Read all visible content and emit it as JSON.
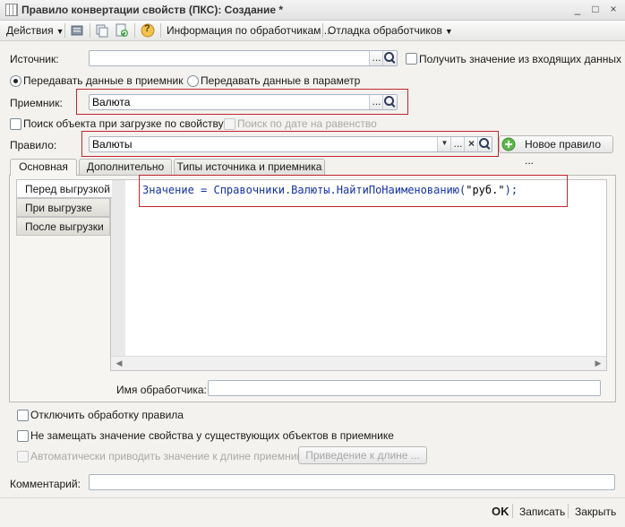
{
  "window": {
    "title": "Правило конвертации свойств (ПКС): Создание *",
    "buttons": [
      "_",
      "□",
      "×"
    ]
  },
  "toolbar": {
    "actions_label": "Действия",
    "help_glyph": "?",
    "handlers_info_label": "Информация по обработчикам ...",
    "debug_label": "Отладка обработчиков"
  },
  "form": {
    "source_label": "Источник:",
    "source_value": "",
    "get_from_incoming_label": "Получить значение из входящих данных",
    "pass_to_receiver_label": "Передавать данные в приемник",
    "pass_to_param_label": "Передавать данные в параметр",
    "receiver_label": "Приемник:",
    "receiver_value": "Валюта",
    "search_by_property_label": "Поиск объекта при загрузке по свойству",
    "search_by_date_label": "Поиск по дате на равенство",
    "rule_label": "Правило:",
    "rule_value": "Валюты",
    "new_rule_label": "Новое правило ...",
    "ellipsis": "...",
    "clear_glyph": "×",
    "dropdown_glyph": "▼"
  },
  "tabs": [
    {
      "label": "Основная",
      "active": true
    },
    {
      "label": "Дополнительно",
      "active": false
    },
    {
      "label": "Типы источника и приемника",
      "active": false
    }
  ],
  "handlers": [
    {
      "label": "Перед выгрузкой",
      "active": true
    },
    {
      "label": "При выгрузке",
      "active": false
    },
    {
      "label": "После выгрузки",
      "active": false
    }
  ],
  "editor": {
    "code_prefix": "Значение = Справочники.Валюты.НайтиПоНаименованию(",
    "code_string": "\"руб.\"",
    "code_suffix": ");"
  },
  "handler_name_label": "Имя обработчика:",
  "handler_name_value": "",
  "options": {
    "disable_rule_label": "Отключить обработку правила",
    "no_replace_label": "Не замещать значение свойства у существующих объектов в приемнике",
    "auto_cast_label": "Автоматически приводить значение к длине приемника",
    "cast_button_label": "Приведение к длине ..."
  },
  "comment_label": "Комментарий:",
  "comment_value": "",
  "footer": {
    "ok_label": "OK",
    "save_label": "Записать",
    "close_label": "Закрыть"
  },
  "colors": {
    "highlight_border": "#c0262d",
    "code_text": "#1432a6",
    "new_rule_icon": "#4caf3f"
  }
}
